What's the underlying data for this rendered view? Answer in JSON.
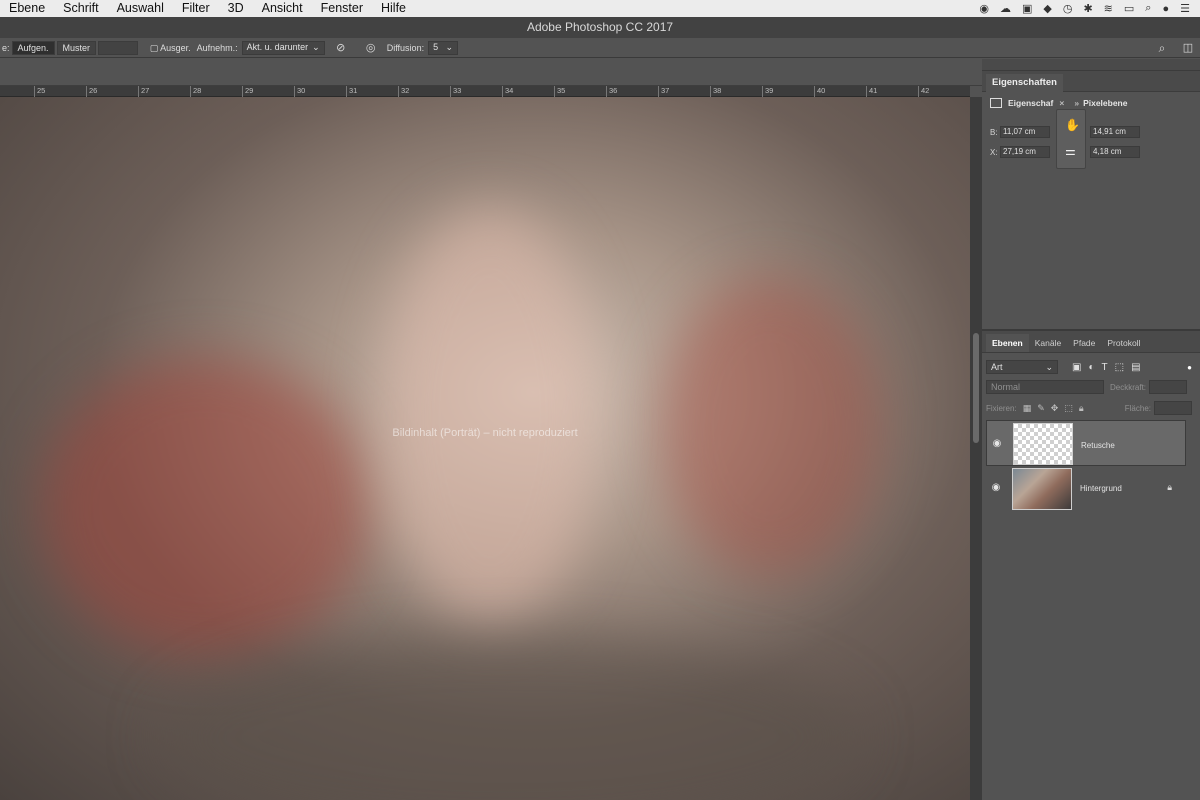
{
  "menu": {
    "items": [
      "Ebene",
      "Schrift",
      "Auswahl",
      "Filter",
      "3D",
      "Ansicht",
      "Fenster",
      "Hilfe"
    ]
  },
  "window": {
    "title": "Adobe Photoshop CC 2017"
  },
  "options": {
    "partial_label": "e:",
    "source_aufgen": "Aufgen.",
    "source_muster": "Muster",
    "ausger_label": "Ausger.",
    "aufnehm_label": "Aufnehm.:",
    "sample_value": "Akt. u. darunter",
    "diffusion_label": "Diffusion:",
    "diffusion_value": "5"
  },
  "ruler": {
    "ticks": [
      "25",
      "26",
      "27",
      "28",
      "29",
      "30",
      "31",
      "32",
      "33",
      "34",
      "35",
      "36",
      "37",
      "38",
      "39",
      "40",
      "41",
      "42"
    ]
  },
  "canvas": {
    "placeholder_text": "Bildinhalt (Porträt) – nicht reproduziert"
  },
  "properties": {
    "tab": "Eigenschaften",
    "row_label": "Eigenschaf",
    "row_sub": "Pixelebene",
    "b_label": "B:",
    "b_value": "11,07 cm",
    "h_value": "14,91 cm",
    "x_label": "X:",
    "x_value": "27,19 cm",
    "y_value": "4,18 cm"
  },
  "layers_panel": {
    "tabs": [
      "Ebenen",
      "Kanäle",
      "Pfade",
      "Protokoll"
    ],
    "filter_value": "Art",
    "blend_mode": "Normal",
    "opacity_label": "Deckkraft:",
    "lock_label": "Fixieren:",
    "fill_label": "Fläche:",
    "layers": [
      {
        "name": "Retusche",
        "selected": true,
        "thumb": "transparent"
      },
      {
        "name": "Hintergrund",
        "selected": false,
        "thumb": "photo",
        "locked": true
      }
    ]
  },
  "colors": {
    "ui_dark": "#535353",
    "panel_bar": "#4a4a4a",
    "selected_layer": "#696969"
  }
}
